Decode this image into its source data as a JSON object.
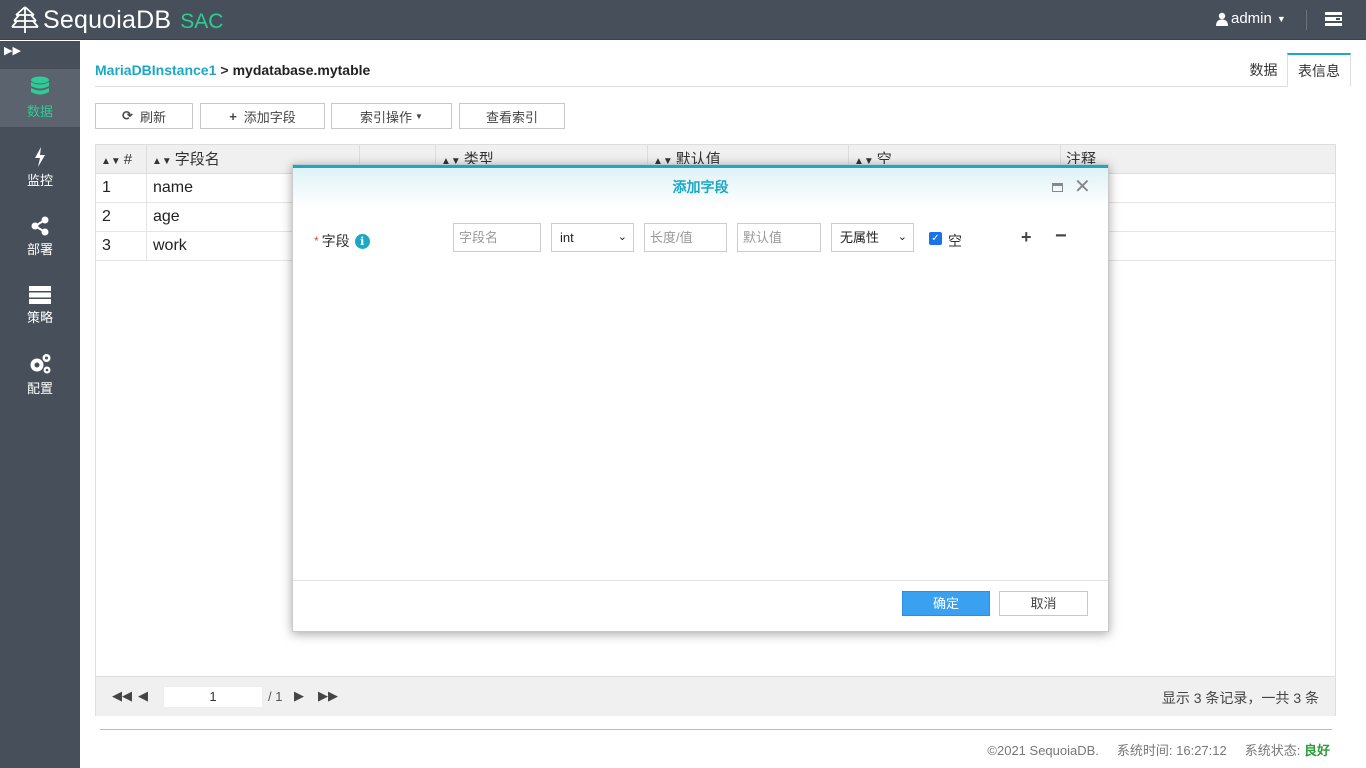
{
  "header": {
    "brand": "SequoiaDB",
    "brand_suffix": "SAC",
    "user": "admin",
    "colors": {
      "bar": "#464f5a",
      "accent": "#2ecc96",
      "link": "#1ba8c7"
    }
  },
  "sidebar": {
    "items": [
      {
        "label": "数据",
        "icon": "database-icon",
        "active": true
      },
      {
        "label": "监控",
        "icon": "bolt-icon"
      },
      {
        "label": "部署",
        "icon": "share-icon"
      },
      {
        "label": "策略",
        "icon": "server-icon"
      },
      {
        "label": "配置",
        "icon": "gears-icon"
      }
    ]
  },
  "breadcrumb": {
    "instance": "MariaDBInstance1",
    "separator": ">",
    "current": "mydatabase.mytable"
  },
  "tabs": [
    {
      "label": "数据"
    },
    {
      "label": "表信息",
      "active": true
    }
  ],
  "toolbar": {
    "refresh": "刷新",
    "add_field": "添加字段",
    "index_ops": "索引操作",
    "view_index": "查看索引"
  },
  "table": {
    "columns": [
      "#",
      "字段名",
      "类型",
      "默认值",
      "空",
      "注释"
    ],
    "rows": [
      {
        "idx": "1",
        "name": "name"
      },
      {
        "idx": "2",
        "name": "age"
      },
      {
        "idx": "3",
        "name": "work"
      }
    ]
  },
  "pager": {
    "page": "1",
    "total": "/ 1",
    "summary": "显示 3 条记录，一共 3 条"
  },
  "footer": {
    "copyright": "©2021 SequoiaDB.",
    "time_label": "系统时间: 16:27:12",
    "status_label": "系统状态:",
    "status_value": "良好"
  },
  "modal": {
    "title": "添加字段",
    "field_label": "字段",
    "name_placeholder": "字段名",
    "type_value": "int",
    "length_placeholder": "长度/值",
    "default_placeholder": "默认值",
    "attr_value": "无属性",
    "null_label": "空",
    "null_checked": true,
    "confirm": "确定",
    "cancel": "取消"
  }
}
